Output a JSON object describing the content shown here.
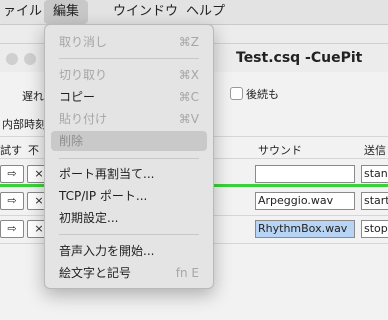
{
  "menubar": {
    "items": [
      {
        "label": "ァイル"
      },
      {
        "label": "編集"
      },
      {
        "label": "ウインドウ"
      },
      {
        "label": "ヘルプ"
      }
    ]
  },
  "window": {
    "title": "Test.csq -CuePit",
    "label_delay": "遅れ",
    "label_internal_clock": "内部時刻",
    "label_after": "後続も",
    "col_test": "試す",
    "col_invalid": "不",
    "col_sound": "サウンド",
    "col_send": "送信",
    "rows": [
      {
        "play": "⇨",
        "x": "×",
        "sound": "",
        "send": "stanc"
      },
      {
        "play": "⇨",
        "x": "×",
        "sound": "Arpeggio.wav",
        "send": "start"
      },
      {
        "play": "⇨",
        "x": "×",
        "sound": "RhythmBox.wav",
        "send": "stop"
      }
    ]
  },
  "edit_menu": {
    "items": [
      {
        "label": "取り消し",
        "shortcut": "⌘Z",
        "state": "disabled"
      },
      {
        "label": "切り取り",
        "shortcut": "⌘X",
        "state": "disabled"
      },
      {
        "label": "コピー",
        "shortcut": "⌘C",
        "state": "enabled"
      },
      {
        "label": "貼り付け",
        "shortcut": "⌘V",
        "state": "disabled"
      },
      {
        "label": "削除",
        "shortcut": "",
        "state": "highlighted"
      },
      {
        "label": "ポート再割当て...",
        "shortcut": "",
        "state": "enabled"
      },
      {
        "label": "TCP/IP ポート...",
        "shortcut": "",
        "state": "enabled"
      },
      {
        "label": "初期設定...",
        "shortcut": "",
        "state": "enabled"
      },
      {
        "label": "音声入力を開始...",
        "shortcut": "",
        "state": "enabled"
      },
      {
        "label": "絵文字と記号",
        "shortcut": "fn E",
        "state": "enabled"
      }
    ]
  },
  "colors": {
    "progress_line": "#3ad23a",
    "selection": "#b7d4f4"
  }
}
